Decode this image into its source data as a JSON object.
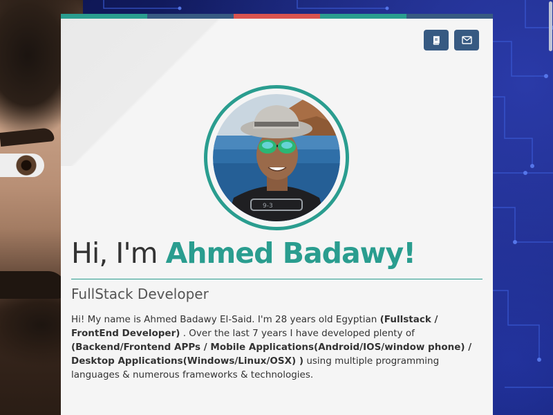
{
  "theme": {
    "accent": "#2a9d8f",
    "button_bg": "#375a82",
    "stripe_colors": [
      "#2a9d8f",
      "#375a82",
      "#d9534f",
      "#2a9d8f",
      "#375a82"
    ]
  },
  "toolbar": {
    "buttons": [
      {
        "icon": "book-icon"
      },
      {
        "icon": "envelope-icon"
      }
    ]
  },
  "profile": {
    "greeting": "Hi, I'm ",
    "name": "Ahmed Badawy!",
    "role": "FullStack Developer",
    "bio": {
      "t1": "Hi! My name is Ahmed Badawy El-Said. I'm 28 years old Egyptian ",
      "b1": "(Fullstack / FrontEnd Developer)",
      "t2": " . Over the last 7 years I have  developed plenty of ",
      "b2": "(Backend/Frontend APPs / Mobile Applications(Android/IOS/window phone) / Desktop Applications(Windows/Linux/OSX) )",
      "t3": " using multiple programming languages & numerous frameworks & technologies."
    }
  },
  "avatar": {
    "shirt_text": "9-3"
  }
}
